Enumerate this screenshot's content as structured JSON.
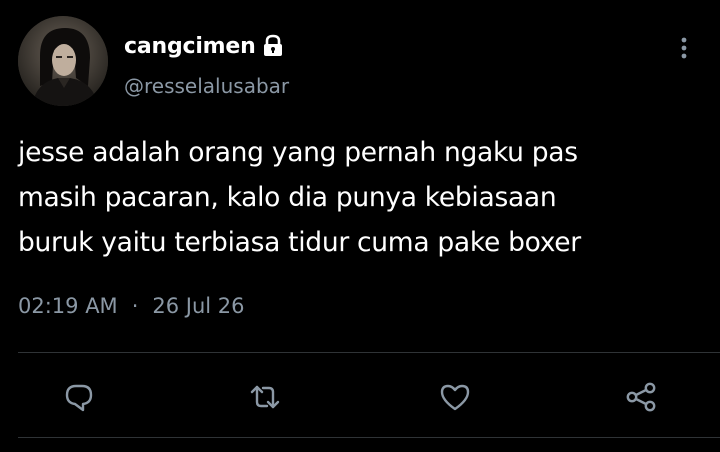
{
  "colors": {
    "background": "#000000",
    "text_primary": "#ffffff",
    "text_secondary": "#8b98a5",
    "divider": "#2f3336"
  },
  "author": {
    "display_name": "cangcimen",
    "handle": "@resselalusabar",
    "protected_icon": "lock-icon",
    "avatar": "profile-photo"
  },
  "tweet": {
    "lines": [
      "jesse adalah orang yang pernah ngaku pas",
      "masih pacaran, kalo dia punya kebiasaan",
      "buruk yaitu terbiasa tidur cuma pake boxer"
    ],
    "time": "02:19 AM",
    "separator": "·",
    "date": "26 Jul 26"
  },
  "actions": [
    {
      "name": "reply",
      "icon": "reply-icon"
    },
    {
      "name": "retweet",
      "icon": "retweet-icon"
    },
    {
      "name": "like",
      "icon": "heart-icon"
    },
    {
      "name": "share",
      "icon": "share-icon"
    }
  ],
  "menu_icon": "more-vertical-icon"
}
